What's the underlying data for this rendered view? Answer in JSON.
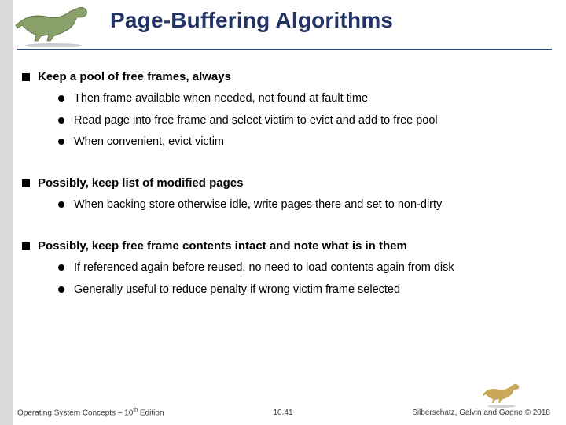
{
  "title": "Page-Buffering Algorithms",
  "bullets": {
    "b1": "Keep a pool of free frames, always",
    "b1a": "Then frame available when needed, not found at fault time",
    "b1b": "Read page into free frame and select victim to evict and add to free pool",
    "b1c": "When convenient, evict victim",
    "b2": "Possibly, keep list of modified pages",
    "b2a": "When backing store otherwise idle, write pages there and set to non-dirty",
    "b3": "Possibly, keep free frame contents intact and note what is in them",
    "b3a": "If referenced again before reused, no need to load contents again from disk",
    "b3b": "Generally useful to reduce penalty if wrong victim frame selected"
  },
  "footer": {
    "left_prefix": "Operating System Concepts – 10",
    "left_suffix": " Edition",
    "left_sup": "th",
    "center": "10.41",
    "right": "Silberschatz, Galvin and Gagne © 2018"
  },
  "icons": {
    "dino_top": "dinosaur-icon",
    "dino_bottom": "dinosaur-icon"
  }
}
